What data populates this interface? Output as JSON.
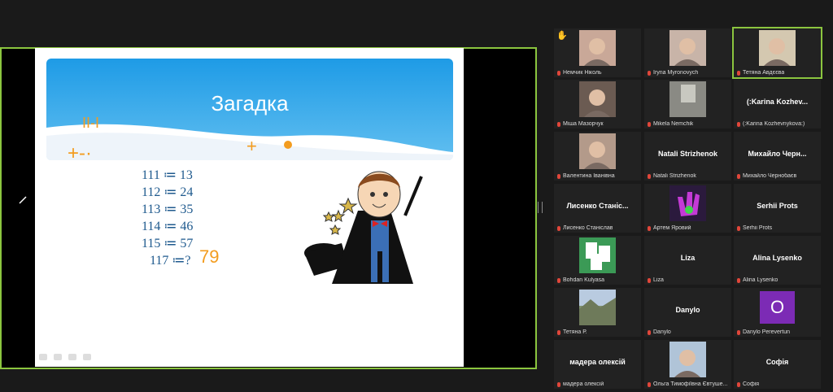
{
  "slide": {
    "title": "Загадка",
    "equations": [
      "111 ≔ 13",
      "112 ≔ 24",
      "113 ≔ 35",
      "114 ≔ 46",
      "115 ≔ 57"
    ],
    "question": "117 ≔?",
    "annotations": {
      "answer": "79",
      "roman": "II-I",
      "ops": "+-·",
      "plus": "+"
    }
  },
  "participants": [
    {
      "name": "Немчик Ніколь",
      "display": "",
      "video": "girl",
      "hand": true
    },
    {
      "name": "Iryna Myronovych",
      "display": "",
      "video": "woman"
    },
    {
      "name": "Тетяна Авдєєва",
      "display": "",
      "video": "woman-light",
      "active": true
    },
    {
      "name": "Міша Мазорчук",
      "display": "",
      "video": "boy"
    },
    {
      "name": "Mikela Nemchik",
      "display": "",
      "video": "room"
    },
    {
      "name": "(:Karina Kozhevnykova:)",
      "display": "(:Karina  Kozhev...",
      "video": ""
    },
    {
      "name": "Валентина Іванівна",
      "display": "",
      "video": "woman2"
    },
    {
      "name": "Natali Strizhenok",
      "display": "Natali Strizhenok",
      "video": ""
    },
    {
      "name": "Михайло Чернобаєв",
      "display": "Михайло  Черн...",
      "video": ""
    },
    {
      "name": "Лисенко Станіслав",
      "display": "Лисенко  Станіс...",
      "video": ""
    },
    {
      "name": "Артем Яровий",
      "display": "",
      "video": "hand"
    },
    {
      "name": "Serhii  Prots",
      "display": "Serhii  Prots",
      "video": ""
    },
    {
      "name": "Bohdan Kulyasa",
      "display": "",
      "video": "cards"
    },
    {
      "name": "Liza",
      "display": "Liza",
      "video": ""
    },
    {
      "name": "Alina Lysenko",
      "display": "Alina Lysenko",
      "video": ""
    },
    {
      "name": "Тетяна Р.",
      "display": "",
      "video": "landscape"
    },
    {
      "name": "Danylo",
      "display": "Danylo",
      "video": ""
    },
    {
      "name": "Danylo Perevertun",
      "display": "",
      "video": "avatar-o",
      "avatar": "O"
    },
    {
      "name": "мадера олексій",
      "display": "мадера олексій",
      "video": ""
    },
    {
      "name": "Ольга Тимофіївна Євтуше...",
      "display": "",
      "video": "woman3"
    },
    {
      "name": "Софія",
      "display": "Софія",
      "video": ""
    }
  ],
  "colors": {
    "accent": "#8bc53f",
    "mic_muted": "#e0463a",
    "slide_text": "#1f5a8e",
    "ink": "#f39c1f"
  }
}
